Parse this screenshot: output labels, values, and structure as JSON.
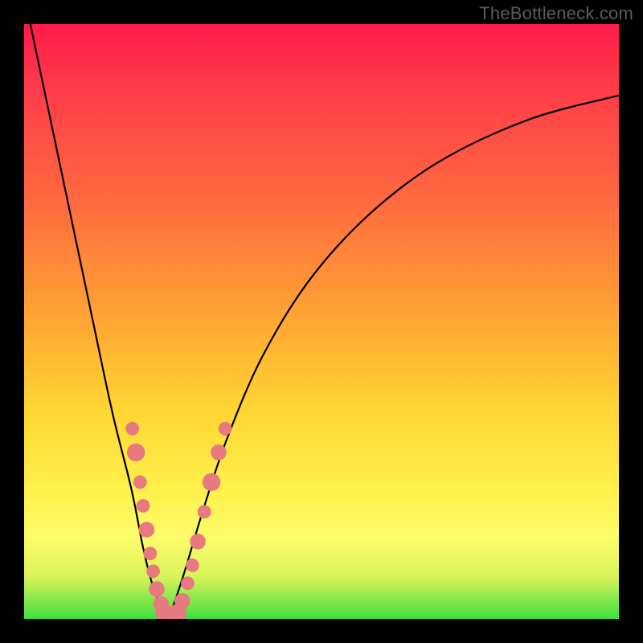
{
  "watermark": "TheBottleneck.com",
  "colors": {
    "gradient_top": "#ff1a4b",
    "gradient_mid1": "#ff6a3f",
    "gradient_mid2": "#ffd633",
    "gradient_mid3": "#fff04a",
    "gradient_bottom": "#3ee03e",
    "curve": "#000000",
    "marker": "#e77a7f",
    "frame": "#000000"
  },
  "chart_data": {
    "type": "line",
    "title": "",
    "xlabel": "",
    "ylabel": "",
    "xlim": [
      0,
      100
    ],
    "ylim": [
      0,
      100
    ],
    "grid": false,
    "legend": false,
    "series": [
      {
        "name": "bottleneck-curve",
        "x": [
          0,
          4,
          8,
          12,
          15,
          18,
          20,
          21.5,
          23,
          24,
          25,
          27,
          30,
          34,
          40,
          48,
          58,
          70,
          85,
          100
        ],
        "y": [
          105,
          86,
          67,
          48,
          34,
          22,
          12,
          6,
          2,
          0,
          2,
          8,
          18,
          30,
          44,
          57,
          68,
          77,
          84,
          88
        ]
      }
    ],
    "markers": [
      {
        "x": 18.2,
        "y": 32,
        "r": 1.2
      },
      {
        "x": 18.8,
        "y": 28,
        "r": 1.6
      },
      {
        "x": 19.5,
        "y": 23,
        "r": 1.2
      },
      {
        "x": 20.0,
        "y": 19,
        "r": 1.2
      },
      {
        "x": 20.6,
        "y": 15,
        "r": 1.4
      },
      {
        "x": 21.2,
        "y": 11,
        "r": 1.2
      },
      {
        "x": 21.7,
        "y": 8,
        "r": 1.2
      },
      {
        "x": 22.3,
        "y": 5,
        "r": 1.4
      },
      {
        "x": 23.0,
        "y": 2.5,
        "r": 1.4
      },
      {
        "x": 23.6,
        "y": 1,
        "r": 1.6
      },
      {
        "x": 24.3,
        "y": 0.3,
        "r": 1.8
      },
      {
        "x": 25.0,
        "y": 0.2,
        "r": 1.6
      },
      {
        "x": 25.8,
        "y": 1,
        "r": 1.6
      },
      {
        "x": 26.6,
        "y": 3,
        "r": 1.4
      },
      {
        "x": 27.5,
        "y": 6,
        "r": 1.2
      },
      {
        "x": 28.3,
        "y": 9,
        "r": 1.2
      },
      {
        "x": 29.2,
        "y": 13,
        "r": 1.4
      },
      {
        "x": 30.3,
        "y": 18,
        "r": 1.2
      },
      {
        "x": 31.5,
        "y": 23,
        "r": 1.6
      },
      {
        "x": 32.7,
        "y": 28,
        "r": 1.4
      },
      {
        "x": 33.8,
        "y": 32,
        "r": 1.2
      }
    ],
    "minimum": {
      "x": 24,
      "y": 0
    }
  }
}
